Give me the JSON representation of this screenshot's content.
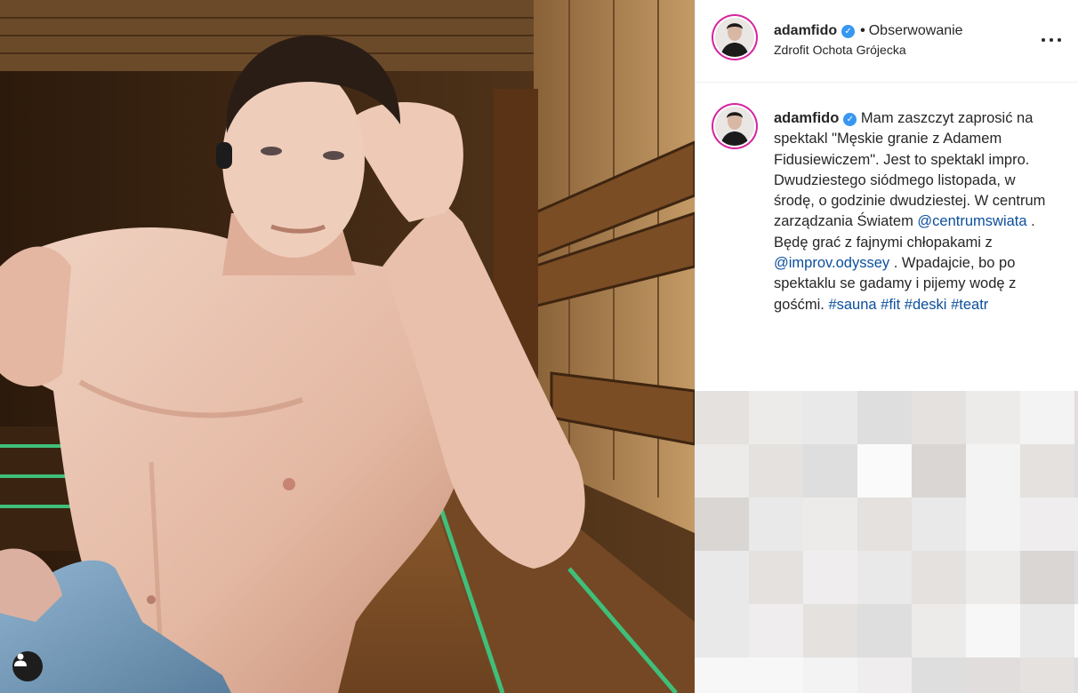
{
  "header": {
    "username": "adamfido",
    "verified_mark": "✓",
    "separator": "•",
    "follow_state": "Obserwowanie",
    "location": "Zdrofit Ochota Grójecka",
    "more_icon": "ellipsis-icon"
  },
  "caption": {
    "username": "adamfido",
    "verified_mark": "✓",
    "text_1": " Mam zaszczyt zaprosić na spektakl \"Męskie granie z Adamem Fidusiewiczem\". Jest to spektakl impro. Dwudziestego siódmego listopada, w środę, o godzinie dwudziestej. W centrum zarządzania Światem ",
    "mention_1": "@centrumswiata",
    "text_2": " . Będę grać z fajnymi chłopakami z ",
    "mention_2": "@improv.odyssey",
    "text_3": " . Wpadajcie, bo po spektaklu se gadamy i pijemy wodę z gośćmi. ",
    "hashtags": [
      "#sauna",
      "#fit",
      "#deski",
      "#teatr"
    ]
  },
  "colors": {
    "verified": "#3897f0",
    "link": "#0b4f9c",
    "story_ring": "#d6249f",
    "text": "#262626"
  },
  "photo": {
    "description_icon": "user-tags-icon"
  }
}
